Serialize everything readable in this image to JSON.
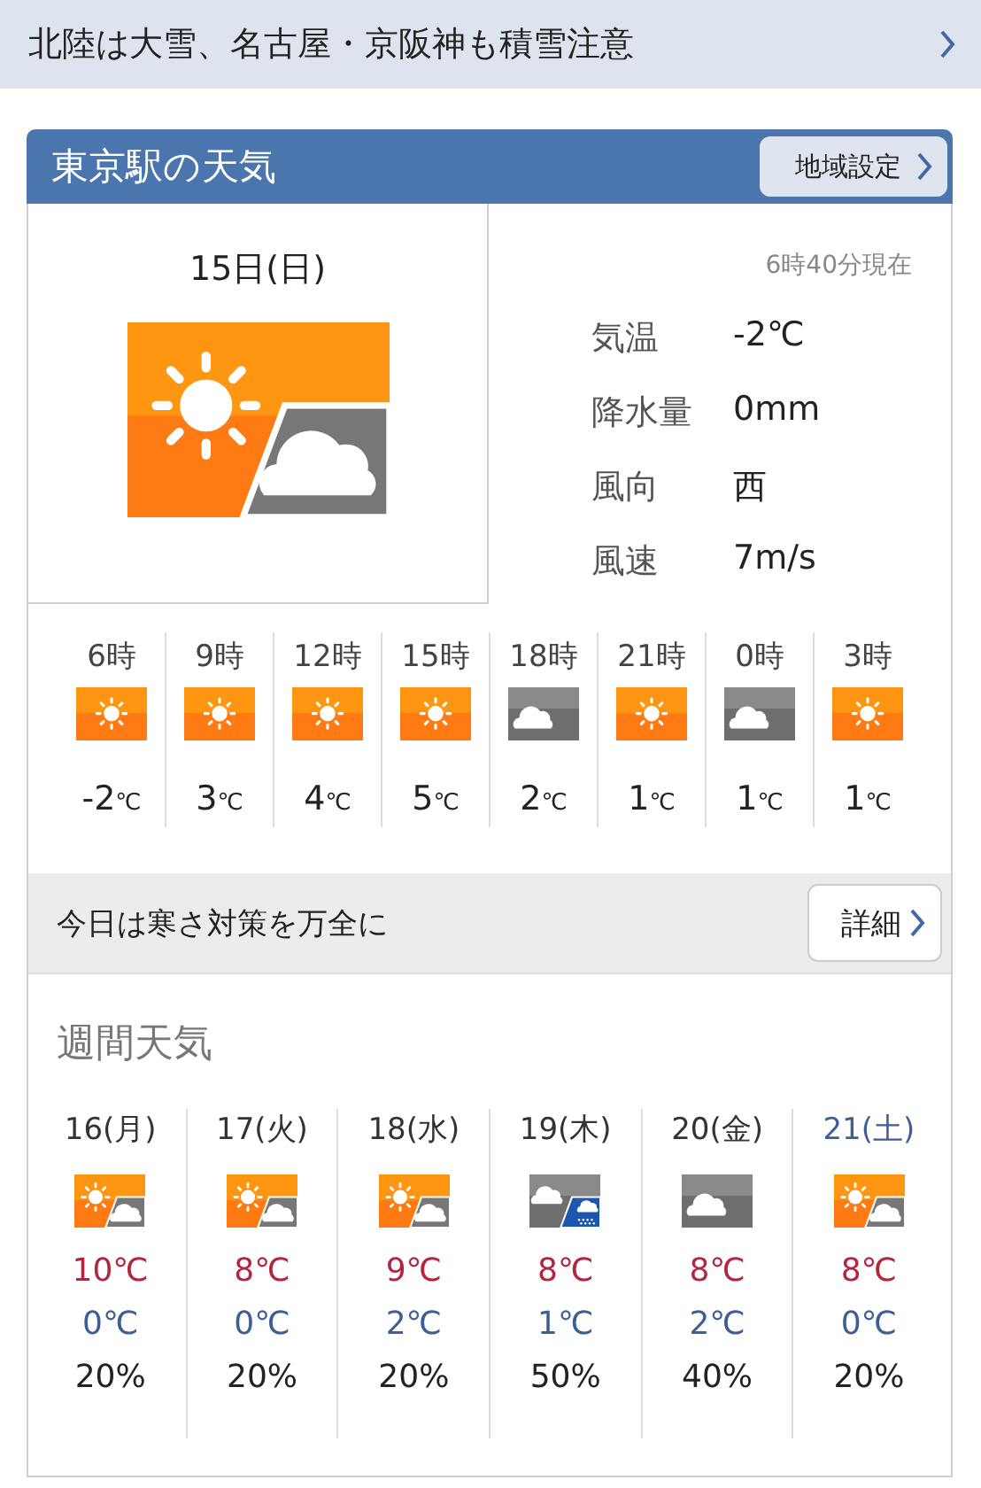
{
  "banner": {
    "text": "北陸は大雪、名古屋・京阪神も積雪注意"
  },
  "card": {
    "title": "東京駅の天気",
    "region_button": "地域設定"
  },
  "today": {
    "date": "15日(日)",
    "kind": "partly",
    "observed": "6時40分現在",
    "stats": [
      {
        "label": "気温",
        "value": "-2℃"
      },
      {
        "label": "降水量",
        "value": "0mm"
      },
      {
        "label": "風向",
        "value": "西"
      },
      {
        "label": "風速",
        "value": "7m/s"
      }
    ]
  },
  "hourly": [
    {
      "time": "6時",
      "kind": "sunny",
      "temp": "-2",
      "unit": "℃"
    },
    {
      "time": "9時",
      "kind": "sunny",
      "temp": "3",
      "unit": "℃"
    },
    {
      "time": "12時",
      "kind": "sunny",
      "temp": "4",
      "unit": "℃"
    },
    {
      "time": "15時",
      "kind": "sunny",
      "temp": "5",
      "unit": "℃"
    },
    {
      "time": "18時",
      "kind": "cloudy",
      "temp": "2",
      "unit": "℃"
    },
    {
      "time": "21時",
      "kind": "sunny",
      "temp": "1",
      "unit": "℃"
    },
    {
      "time": "0時",
      "kind": "cloudy",
      "temp": "1",
      "unit": "℃"
    },
    {
      "time": "3時",
      "kind": "sunny",
      "temp": "1",
      "unit": "℃"
    }
  ],
  "advice": {
    "text": "今日は寒さ対策を万全に",
    "button": "詳細"
  },
  "weekly": {
    "title": "週間天気",
    "days": [
      {
        "date": "16(月)",
        "color": "#333333",
        "kind": "partly",
        "high": "10℃",
        "low": "0℃",
        "rain": "20%"
      },
      {
        "date": "17(火)",
        "color": "#333333",
        "kind": "partly",
        "high": "8℃",
        "low": "0℃",
        "rain": "20%"
      },
      {
        "date": "18(水)",
        "color": "#333333",
        "kind": "partly",
        "high": "9℃",
        "low": "2℃",
        "rain": "20%"
      },
      {
        "date": "19(木)",
        "color": "#333333",
        "kind": "showers",
        "high": "8℃",
        "low": "1℃",
        "rain": "50%"
      },
      {
        "date": "20(金)",
        "color": "#333333",
        "kind": "cloudy",
        "high": "8℃",
        "low": "2℃",
        "rain": "40%"
      },
      {
        "date": "21(土)",
        "color": "#3d5f95",
        "kind": "partly",
        "high": "8℃",
        "low": "0℃",
        "rain": "20%"
      }
    ]
  }
}
